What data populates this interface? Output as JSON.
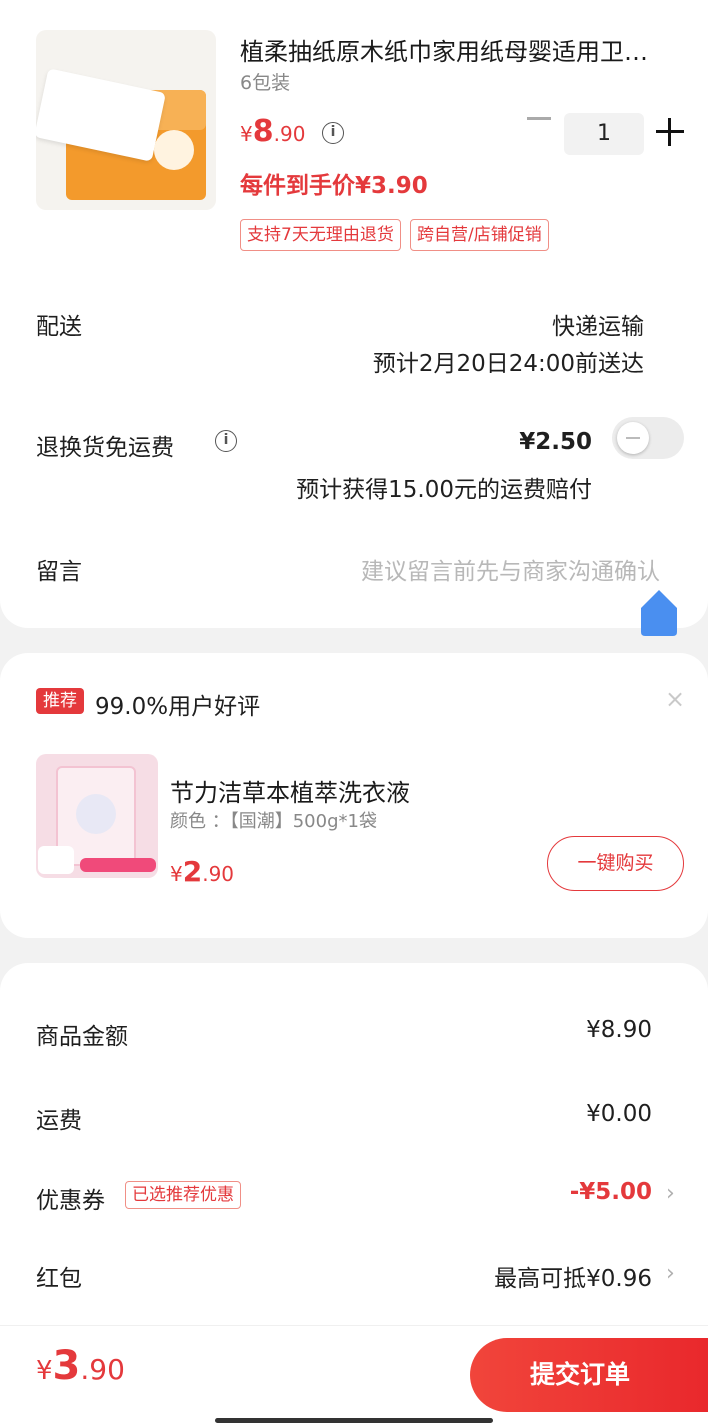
{
  "product": {
    "title": "植柔抽纸原木纸巾家用纸母婴适用卫…",
    "spec": "6包装",
    "price": {
      "symbol": "¥",
      "int": "8",
      "dec": ".90"
    },
    "quantity": "1",
    "unit_price": "每件到手价¥3.90",
    "tags": [
      "支持7天无理由退货",
      "跨自营/店铺促销"
    ]
  },
  "delivery": {
    "label": "配送",
    "method": "快递运输",
    "estimate": "预计2月20日24:00前送达"
  },
  "return_shipping": {
    "label": "退换货免运费",
    "price": "¥2.50",
    "note": "预计获得15.00元的运费赔付",
    "enabled": false
  },
  "message": {
    "label": "留言",
    "placeholder": "建议留言前先与商家沟通确认"
  },
  "recommend": {
    "badge": "推荐",
    "text": "99.0%用户好评",
    "close": "×",
    "name": "节力洁草本植萃洗衣液",
    "spec": "颜色 ：【国潮】500g*1袋",
    "price": {
      "symbol": "¥",
      "int": "2",
      "dec": ".90"
    },
    "buy_label": "一键购买"
  },
  "summary": {
    "goods_label": "商品金额",
    "goods_value": "¥8.90",
    "freight_label": "运费",
    "freight_value": "¥0.00",
    "coupon_label": "优惠券",
    "coupon_tag": "已选推荐优惠",
    "coupon_value": "-¥5.00",
    "redpack_label": "红包",
    "redpack_value": "最高可抵¥0.96"
  },
  "footer": {
    "total": {
      "symbol": "¥",
      "int": "3",
      "dec": ".90"
    },
    "submit_label": "提交订单"
  },
  "colors": {
    "accent": "#e4393c",
    "float_button": "#4a8ff0"
  }
}
